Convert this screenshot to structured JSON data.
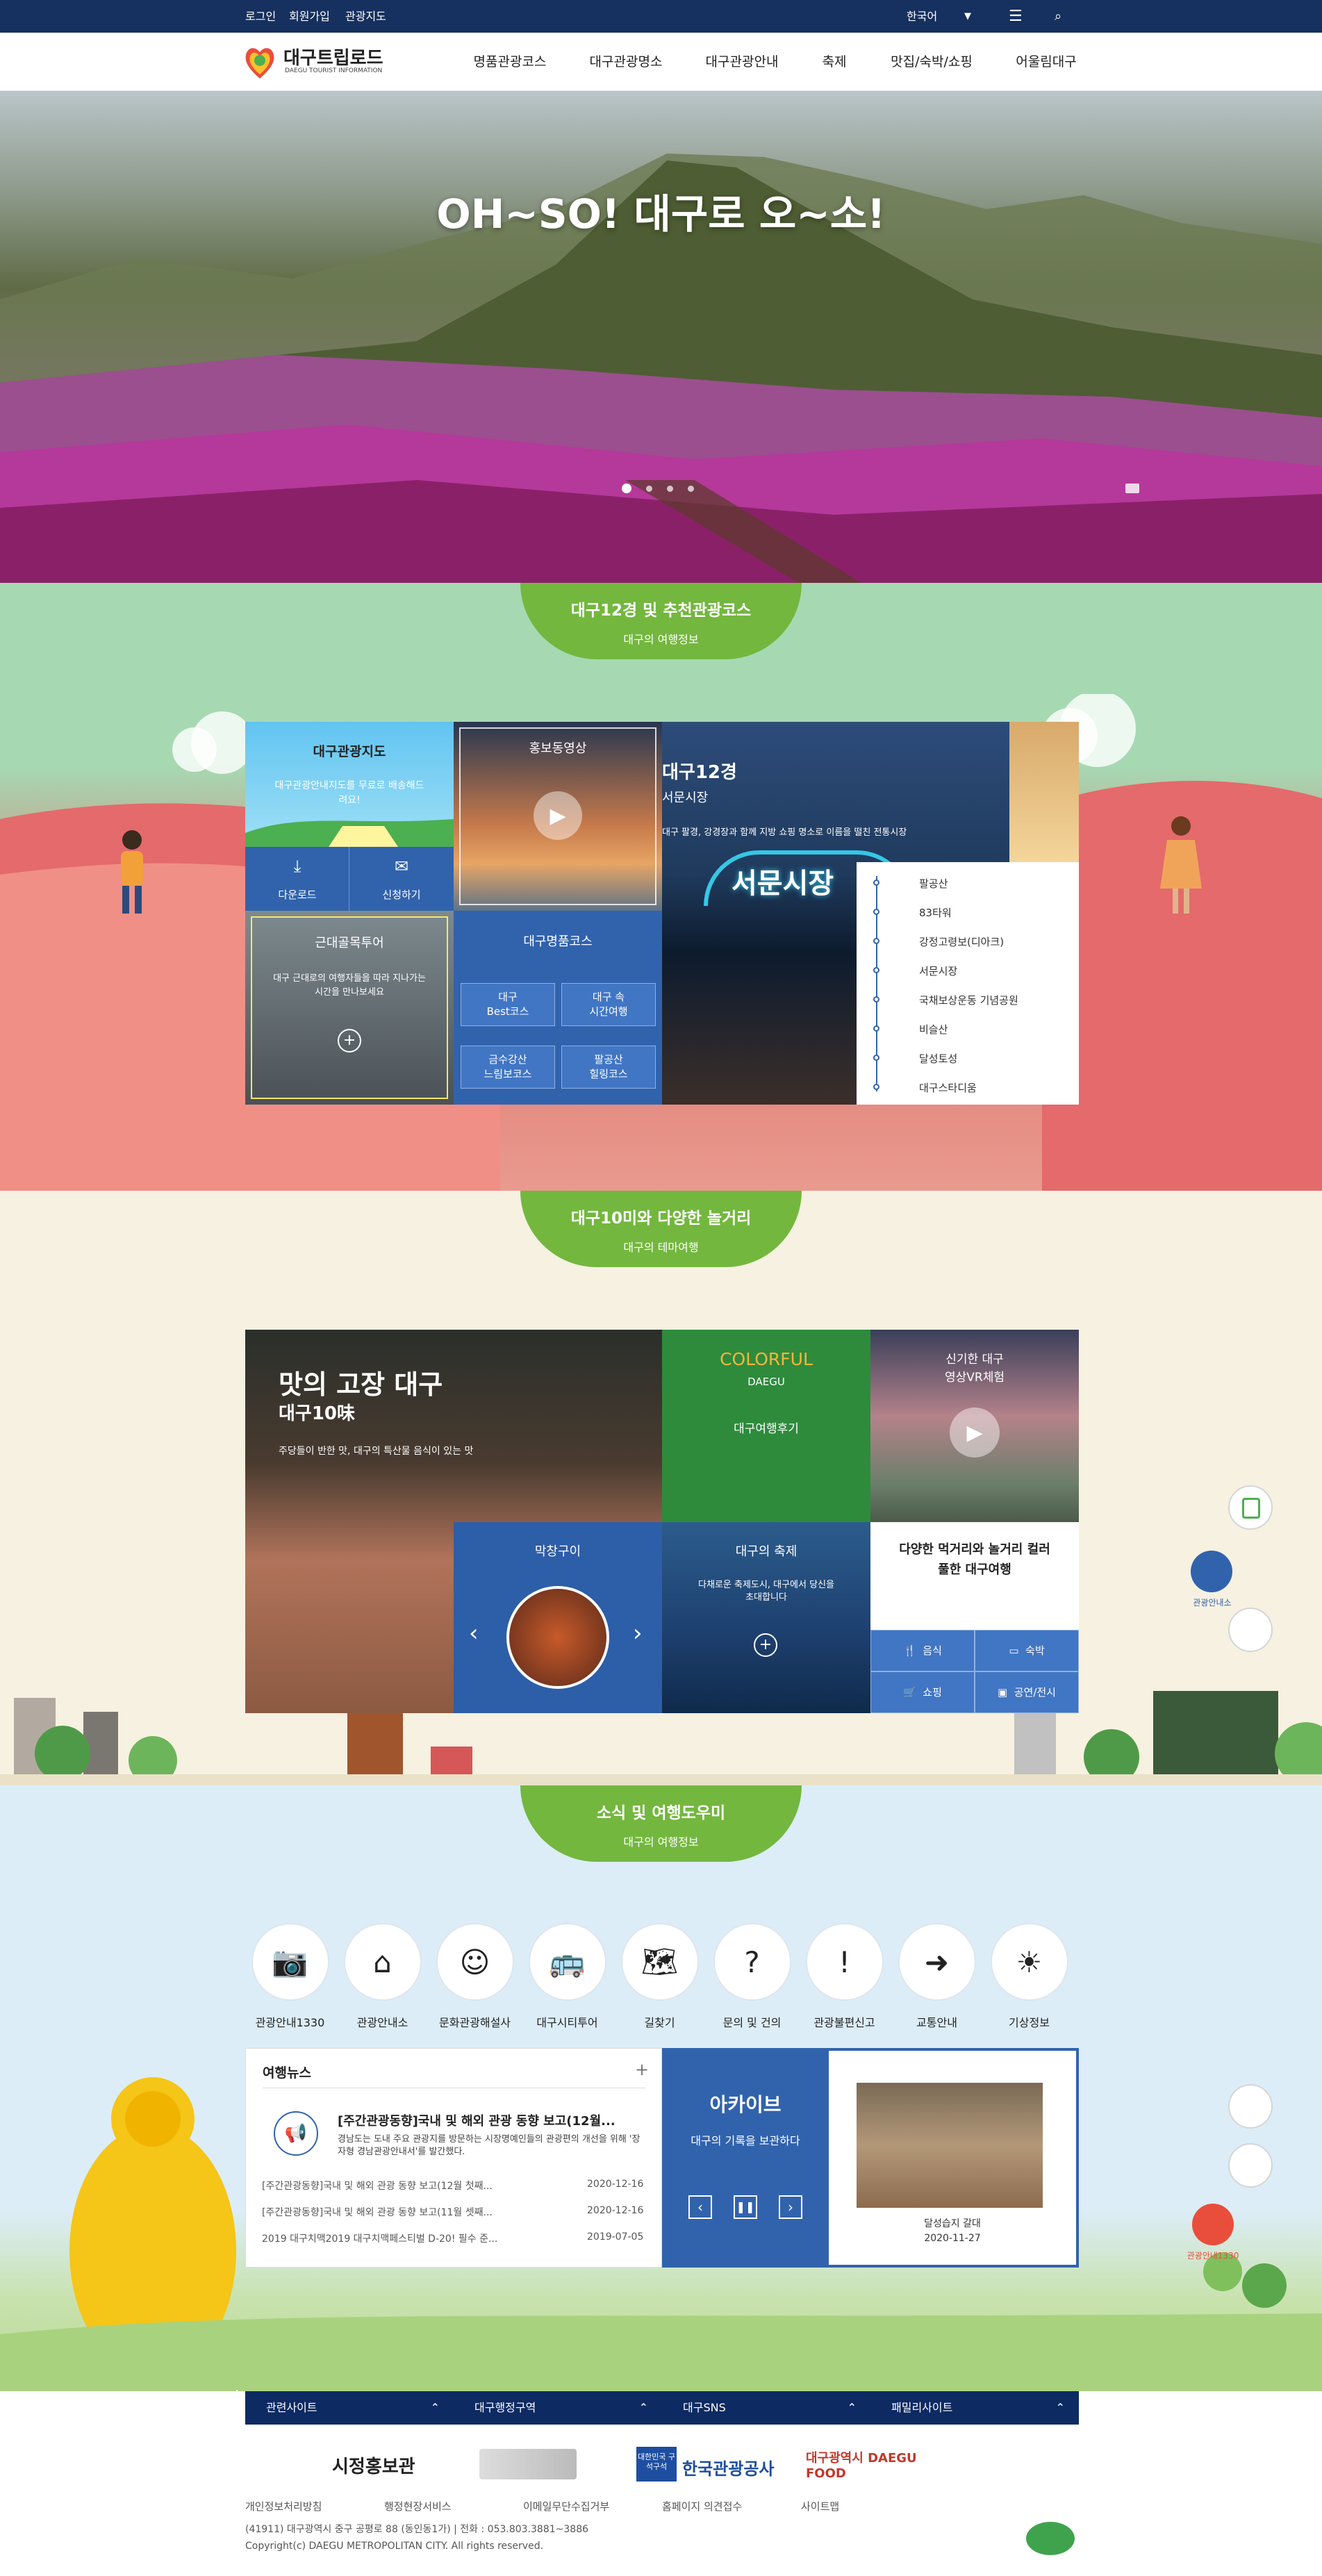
{
  "util": {
    "login": "로그인",
    "join": "회원가입",
    "map": "관광지도",
    "lang": "한국어"
  },
  "header": {
    "logo_title": "대구트립로드",
    "logo_sub": "DAEGU TOURIST INFORMATION",
    "nav": [
      "명품관광코스",
      "대구관광명소",
      "대구관광안내",
      "축제",
      "맛집/숙박/쇼핑",
      "어울림대구"
    ]
  },
  "hero": {
    "title": "OH~SO! 대구로 오~소!"
  },
  "sec1": {
    "title": "대구12경 및 추천관광코스",
    "sub": "대구의 여행정보"
  },
  "tiles1": {
    "map_title": "대구관광지도",
    "map_desc": "대구관광안내지도를 무료로 배송해드려요!",
    "download": "다운로드",
    "apply": "신청하기",
    "promo_title": "홍보동영상",
    "alley_title": "근대골목투어",
    "alley_desc": "대구 근대로의 여행자들을 따라 지나가는 시간을 만나보세요",
    "course_title": "대구명품코스",
    "courses": [
      "대구\nBest코스",
      "대구 속\n시간여행",
      "금수강산\n느림보코스",
      "팔공산\n힐링코스"
    ],
    "twelve_title": "대구12경",
    "twelve_sub": "서문시장",
    "twelve_desc": "대구 팔경, 강경장과 함께 지방 쇼핑 명소로 이름을 떨친 전통시장",
    "market_sign": "서문시장",
    "landmarks": [
      "팔공산",
      "83타워",
      "강정고령보(디아크)",
      "서문시장",
      "국채보상운동 기념공원",
      "비슬산",
      "달성토성",
      "대구스타디움"
    ]
  },
  "sec2": {
    "title": "대구10미와 다양한 놀거리",
    "sub": "대구의 테마여행"
  },
  "tiles2": {
    "food_title": "맛의 고장 대구",
    "food_sub": "대구10味",
    "food_desc": "주당들이 반한 맛, 대구의 특산물 음식이 있는 맛",
    "colorful": "COLORFUL",
    "daegu": "DAEGU",
    "review": "대구여행후기",
    "vr_title": "신기한 대구",
    "vr_sub": "영상VR체험",
    "food_item": "막창구이",
    "fest_title": "대구의 축제",
    "fest_desc": "다채로운 축제도시, 대구에서 당신을 초대합니다",
    "fun_title": "다양한 먹거리와 놀거리 컬러풀한 대구여행",
    "cats": [
      "음식",
      "숙박",
      "쇼핑",
      "공연/전시"
    ]
  },
  "sec3": {
    "title": "소식 및 여행도우미",
    "sub": "대구의 여행정보"
  },
  "services": [
    "관광안내1330",
    "관광안내소",
    "문화관광해설사",
    "대구시티투어",
    "길찾기",
    "문의 및 건의",
    "관광불편신고",
    "교통안내",
    "기상정보"
  ],
  "news": {
    "title": "여행뉴스",
    "more": "+",
    "headline": "[주간관광동향]국내 및 해외 관광 동향 보고(12월...",
    "headline_desc": "경남도는 도내 주요 관광지를 방문하는 시장명예인들의 관광편의 개선을 위해 '장자형 경남관광안내서'를 발간했다.",
    "items": [
      {
        "t": "[주간관광동향]국내 및 해외 관광 동향 보고(12월 첫째...",
        "d": "2020-12-16"
      },
      {
        "t": "[주간관광동향]국내 및 해외 관광 동향 보고(11월 셋째...",
        "d": "2020-12-16"
      },
      {
        "t": "2019 대구치맥2019 대구치맥페스티벌 D-20! 필수 준...",
        "d": "2019-07-05"
      }
    ]
  },
  "archive": {
    "title": "아카이브",
    "desc": "대구의 기록을 보관하다",
    "photo_title": "달성습지 갈대",
    "photo_date": "2020-11-27"
  },
  "side": {
    "info_center": "관광안내소",
    "info_1330": "관광안내1330"
  },
  "footer": {
    "tabs": [
      "관련사이트",
      "대구행정구역",
      "대구SNS",
      "패밀리사이트"
    ],
    "logos": [
      "시정홍보관",
      "대한민국 구석구석",
      "한국관광공사",
      "대구광역시 DAEGU FOOD"
    ],
    "links": [
      "개인정보처리방침",
      "행정현장서비스",
      "이메일무단수집거부",
      "홈페이지 의견접수",
      "사이트맵"
    ],
    "address": "(41911) 대구광역시 중구 공평로 88 (동인동1가) | 전화 : 053.803.3881~3886",
    "copyright": "Copyright(c) DAEGU METROPOLITAN CITY. All rights reserved."
  },
  "colors": {
    "navy": "#16305f",
    "green": "#73b73f",
    "blue": "#3163ad",
    "red": "#e36a6a"
  }
}
